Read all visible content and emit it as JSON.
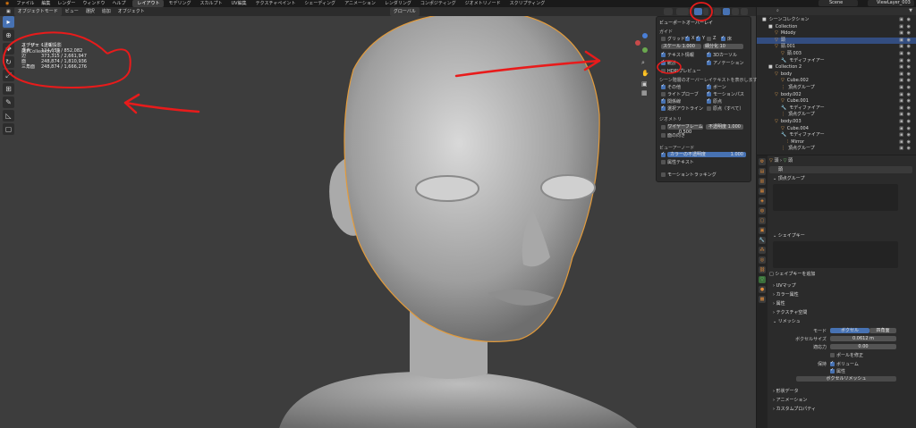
{
  "menu": [
    "ファイル",
    "編集",
    "レンダー",
    "ウィンドウ",
    "ヘルプ"
  ],
  "workspaces": [
    "レイアウト",
    "モデリング",
    "スカルプト",
    "UV編集",
    "テクスチャペイント",
    "シェーディング",
    "アニメーション",
    "レンダリング",
    "コンポジティング",
    "ジオメトリノード",
    "スクリプティング"
  ],
  "scene": "Scene",
  "view_layer": "ViewLayer_003",
  "viewport_header": [
    "オブジェクトモード",
    "ビュー",
    "選択",
    "追加",
    "オブジェクト"
  ],
  "pivot_label": "グローバル",
  "viewport": {
    "title": "ユーザー・透視投影",
    "subtitle": "(1) Collection | 頭",
    "stats": [
      {
        "label": "オブジェクト",
        "value": "1 / 9"
      },
      {
        "label": "頂点",
        "value": "124,659 / 852,082"
      },
      {
        "label": "辺",
        "value": "373,315 / 2,661,947"
      },
      {
        "label": "面",
        "value": "248,874 / 1,810,936"
      },
      {
        "label": "三角面",
        "value": "248,874 / 1,666,276"
      }
    ]
  },
  "tools": [
    "select-tool",
    "cursor-tool",
    "move-tool",
    "rotate-tool",
    "scale-tool",
    "transform-tool",
    "annotate-tool",
    "measure-tool",
    "add-cube-tool"
  ],
  "overlay": {
    "header": "ビューポートオーバーレイ",
    "guides_title": "ガイド",
    "grid_label": "グリッド",
    "axis_labels": [
      "X",
      "Y",
      "Z"
    ],
    "floor_label": "床",
    "scale_label": "スケール",
    "scale_value": "1.000",
    "subdiv_label": "細分化",
    "subdiv_value": "10",
    "text_info": "テキスト情報",
    "stats": "統計",
    "cursor": "3Dカーソル",
    "hdri": "HDRIプレビュー",
    "annotation": "アノテーション",
    "objects_title": "シーン階層のオーバーレイテキストを表示します",
    "extras": "その他",
    "bones": "ボーン",
    "relationship": "関係線",
    "motion_paths": "モーションパス",
    "outline": "選択アウトライン",
    "origins": "原点",
    "origins_all": "原点（すべて）",
    "light_probes": "ライトプローブ",
    "geometry_title": "ジオメトリ",
    "wireframe_label": "ワイヤーフレーム",
    "wireframe_value": "0.500",
    "opacity_label": "不透明度",
    "opacity_value": "1.000",
    "face_orientation": "面の向き",
    "viewer_title": "ビューアーノード",
    "color_opacity": "カラーの不透明度",
    "color_opacity_value": "1.000",
    "attr_text": "属性テキスト",
    "motion_tracking": "モーショントラッキング"
  },
  "outliner": {
    "rows": [
      {
        "name": "シーンコレクション",
        "indent": 0,
        "icon": "■",
        "sel": false
      },
      {
        "name": "Collection",
        "indent": 1,
        "icon": "■",
        "sel": false
      },
      {
        "name": "Mdody",
        "indent": 2,
        "icon": "▽",
        "sel": false
      },
      {
        "name": "頭",
        "indent": 2,
        "icon": "▽",
        "sel": true
      },
      {
        "name": "頭.001",
        "indent": 2,
        "icon": "▽",
        "sel": false
      },
      {
        "name": "頭.003",
        "indent": 3,
        "icon": "▽",
        "sel": false
      },
      {
        "name": "モディファイアー",
        "indent": 3,
        "icon": "🔧",
        "sel": false
      },
      {
        "name": "Collection 2",
        "indent": 1,
        "icon": "■",
        "sel": false
      },
      {
        "name": "body",
        "indent": 2,
        "icon": "▽",
        "sel": false
      },
      {
        "name": "Cube.002",
        "indent": 3,
        "icon": "▽",
        "sel": false
      },
      {
        "name": "頂点グループ",
        "indent": 3,
        "icon": "⋮",
        "sel": false
      },
      {
        "name": "body.002",
        "indent": 2,
        "icon": "▽",
        "sel": false
      },
      {
        "name": "Cube.001",
        "indent": 3,
        "icon": "▽",
        "sel": false
      },
      {
        "name": "モディファイアー",
        "indent": 3,
        "icon": "🔧",
        "sel": false
      },
      {
        "name": "頂点グループ",
        "indent": 3,
        "icon": "⋮",
        "sel": false
      },
      {
        "name": "body.003",
        "indent": 2,
        "icon": "▽",
        "sel": false
      },
      {
        "name": "Cube.004",
        "indent": 3,
        "icon": "▽",
        "sel": false
      },
      {
        "name": "モディファイアー",
        "indent": 3,
        "icon": "🔧",
        "sel": false
      },
      {
        "name": "Mirror",
        "indent": 4,
        "icon": "⫶",
        "sel": false
      },
      {
        "name": "頂点グループ",
        "indent": 3,
        "icon": "⋮",
        "sel": false
      }
    ]
  },
  "properties": {
    "object_name": "頭",
    "mesh_name": "頭",
    "panels": [
      "頂点グループ",
      "シェイプキー",
      "UVマップ",
      "カラー属性",
      "属性",
      "テクスチャ空間",
      "リメッシュ",
      "形状データ",
      "アニメーション",
      "カスタムプロパティ"
    ],
    "shape_key_btn": "シェイプキーを追加",
    "remesh": {
      "mode_label": "モード",
      "mode_options": [
        "ボクセル",
        "四角面"
      ],
      "voxel_size_label": "ボクセルサイズ",
      "voxel_size": "0.0612 m",
      "adaptivity_label": "適応力",
      "adaptivity": "0.00",
      "fix_poles": "ポールを修正",
      "preserve_label": "保持",
      "preserve_volume": "ボリューム",
      "preserve_attr": "属性",
      "remesh_btn": "ボクセルリメッシュ"
    }
  }
}
